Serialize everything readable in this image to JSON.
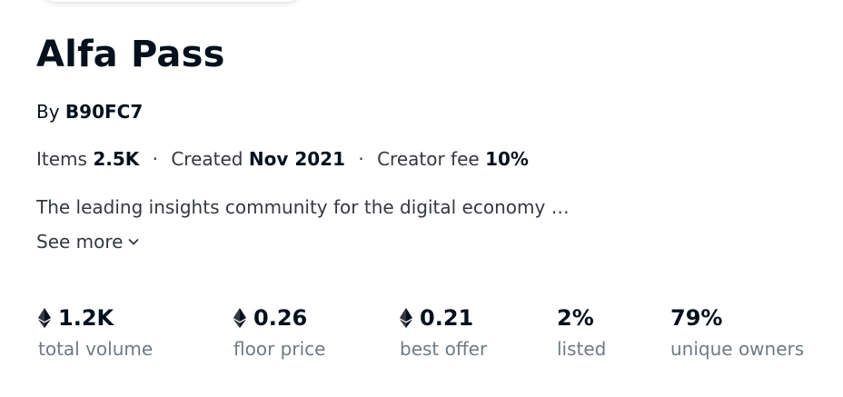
{
  "collection": {
    "title": "Alfa Pass",
    "by_label": "By",
    "creator": "B90FC7",
    "items_label": "Items",
    "items_value": "2.5K",
    "created_label": "Created",
    "created_value": "Nov 2021",
    "fee_label": "Creator fee",
    "fee_value": "10%",
    "separator": "·",
    "description": "The leading insights community for the digital economy …",
    "see_more": "See more"
  },
  "stats": [
    {
      "value": "1.2K",
      "label": "total volume",
      "icon": "ethereum-icon"
    },
    {
      "value": "0.26",
      "label": "floor price",
      "icon": "ethereum-icon"
    },
    {
      "value": "0.21",
      "label": "best offer",
      "icon": "ethereum-icon"
    },
    {
      "value": "2%",
      "label": "listed"
    },
    {
      "value": "79%",
      "label": "unique owners"
    }
  ],
  "colors": {
    "text_primary": "#04111d",
    "text_secondary": "#353840",
    "text_muted": "#707a83",
    "background": "#ffffff"
  }
}
